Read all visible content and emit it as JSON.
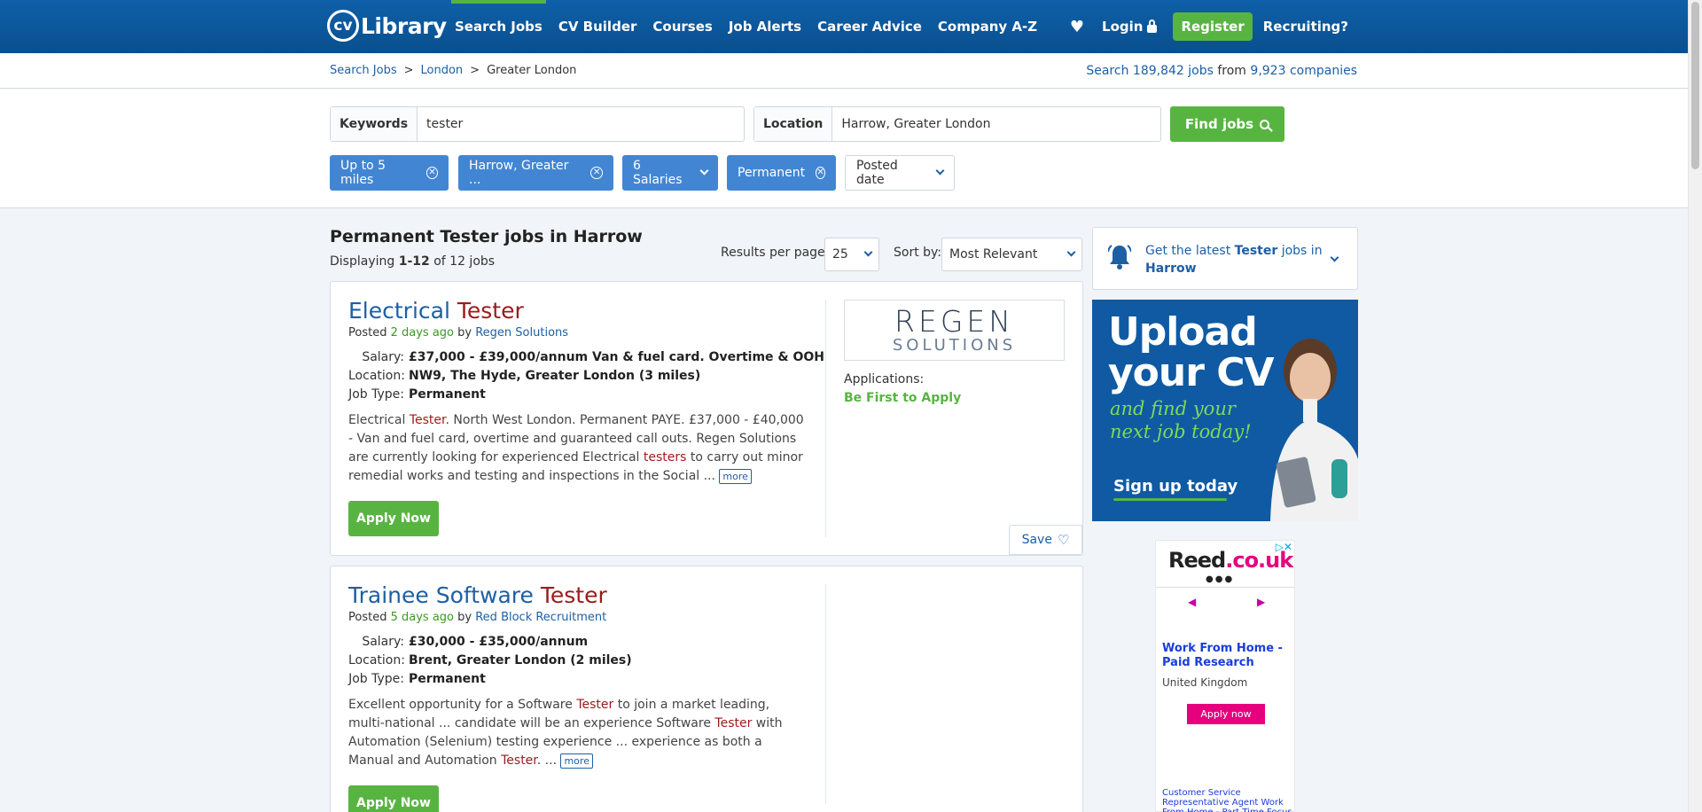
{
  "header": {
    "logo_cv": "cv",
    "logo_text": "Library",
    "nav": [
      "Search Jobs",
      "CV Builder",
      "Courses",
      "Job Alerts",
      "Career Advice",
      "Company A-Z"
    ],
    "login": "Login",
    "register": "Register",
    "recruiting": "Recruiting?"
  },
  "breadcrumb": {
    "items": [
      "Search Jobs",
      "London"
    ],
    "current": "Greater London"
  },
  "stats": {
    "prefix": "Search",
    "jobs_count": "189,842",
    "jobs_word": "jobs",
    "from_word": "from",
    "companies_count": "9,923",
    "companies_word": "companies"
  },
  "search": {
    "keywords_label": "Keywords",
    "keywords_value": "tester",
    "location_label": "Location",
    "location_value": "Harrow, Greater London",
    "find_label": "Find jobs"
  },
  "filters": {
    "distance": "Up to 5 miles",
    "location": "Harrow, Greater ...",
    "salaries": "6 Salaries",
    "jobtype": "Permanent",
    "posted": "Posted date"
  },
  "results": {
    "title": "Permanent Tester jobs in Harrow",
    "displaying": "Displaying",
    "range": "1-12",
    "of_text": "of 12 jobs",
    "per_page_label": "Results per page:",
    "per_page_value": "25",
    "sort_label": "Sort by:",
    "sort_value": "Most Relevant"
  },
  "jobs": [
    {
      "title_plain": "Electrical ",
      "title_hl": "Tester",
      "posted_prefix": "Posted",
      "posted_when": "2 days ago",
      "by": "by",
      "company": "Regen Solutions",
      "salary_label": "Salary:",
      "salary": "£37,000 - £39,000/annum Van & fuel card. Overtime & OOH",
      "location_label": "Location:",
      "location": "NW9, The Hyde, Greater London (3 miles)",
      "jobtype_label": "Job Type:",
      "jobtype": "Permanent",
      "desc_1": "Electrical ",
      "desc_hl1": "Tester",
      "desc_2": ". North West London. Permanent PAYE. £37,000 - £40,000 - Van and fuel card, overtime and guaranteed call outs. Regen Solutions are currently looking for experienced Electrical ",
      "desc_hl2": "testers",
      "desc_3": " to carry out minor remedial works and testing and inspections in the Social ... ",
      "more": "more",
      "apply": "Apply Now",
      "logo_main": "REGEN",
      "logo_sub": "SOLUTIONS",
      "applications_label": "Applications:",
      "applications_value": "Be First to Apply",
      "save": "Save"
    },
    {
      "title_plain": "Trainee Software ",
      "title_hl": "Tester",
      "posted_prefix": "Posted",
      "posted_when": "5 days ago",
      "by": "by",
      "company": "Red Block Recruitment",
      "salary_label": "Salary:",
      "salary": "£30,000 - £35,000/annum",
      "location_label": "Location:",
      "location": "Brent, Greater London (2 miles)",
      "jobtype_label": "Job Type:",
      "jobtype": "Permanent",
      "desc_1": "Excellent opportunity for a Software ",
      "desc_hl1": "Tester",
      "desc_2": " to join a market leading, multi-national ... candidate will be an experience Software ",
      "desc_hl2": "Tester",
      "desc_3": " with Automation (Selenium) testing experience ... experience as both a Manual and Automation ",
      "desc_hl3": "Tester",
      "desc_4": ". ... ",
      "more": "more",
      "apply": "Apply Now"
    }
  ],
  "alert": {
    "t1": "Get the latest ",
    "t_hl": "Tester",
    "t2": " jobs in ",
    "t_loc": "Harrow"
  },
  "banner": {
    "line1": "Upload",
    "line2": "your CV",
    "sub1": "and find your",
    "sub2": "next job today!",
    "cta": "Sign up today"
  },
  "ad": {
    "logo_a": "Reed",
    "logo_b": ".co.uk",
    "headline": "Work From Home - Paid Research",
    "region": "United Kingdom",
    "button": "Apply now",
    "footer": "Customer Service Representative Agent Work From Home - Part Time Focus"
  },
  "colors": {
    "brand_blue": "#0e60a8",
    "accent_green": "#58b441",
    "chip_blue": "#4286d3",
    "highlight_red": "#9b1b1b"
  }
}
